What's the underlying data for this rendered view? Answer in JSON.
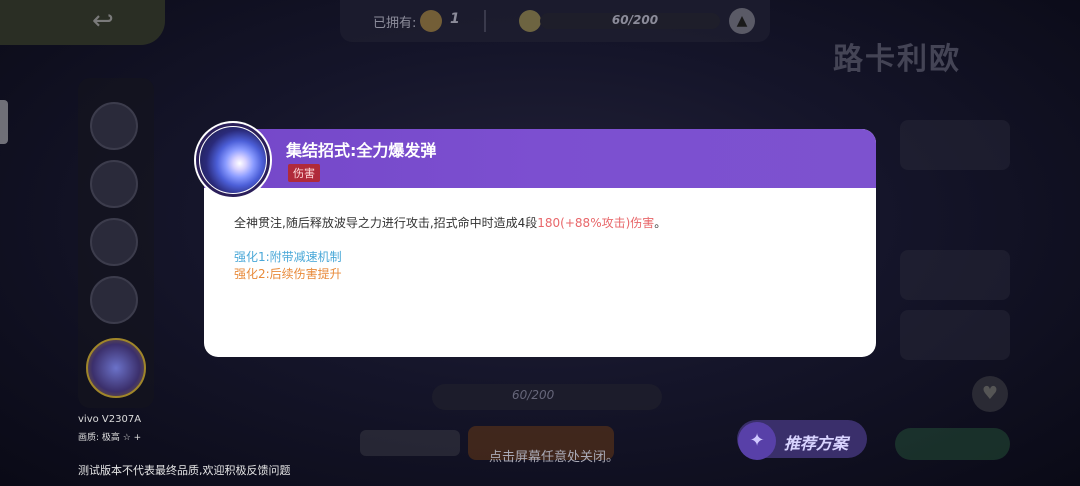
{
  "top_bar": {
    "owned_label": "已拥有:",
    "owned_count": "1",
    "coin_progress": "60/200",
    "up_icon": "arrow-up-icon"
  },
  "hero": {
    "name": "路卡利欧"
  },
  "device": {
    "name": "vivo V2307A",
    "quality": "画质: 极高 ☆ +"
  },
  "notice": "测试版本不代表最终品质,欢迎积极反馈问题",
  "bottom": {
    "bar_text": "60/200",
    "close_hint": "点击屏幕任意处关闭。",
    "recommend": "推荐方案"
  },
  "modal": {
    "title": "集结招式:全力爆发弹",
    "badge": "伤害",
    "desc_prefix": "全神贯注,随后释放波导之力进行攻击,招式命中时造成4段",
    "desc_highlight": "180(+88%攻击)伤害",
    "desc_suffix": "。",
    "enhance1": "强化1:附带减速机制",
    "enhance2": "强化2:后续伤害提升"
  },
  "colors": {
    "header": "#7447c8",
    "highlight": "#e8676a",
    "enh1": "#4aa8d8",
    "enh2": "#e88a3a",
    "badge": "#b02a3a"
  }
}
